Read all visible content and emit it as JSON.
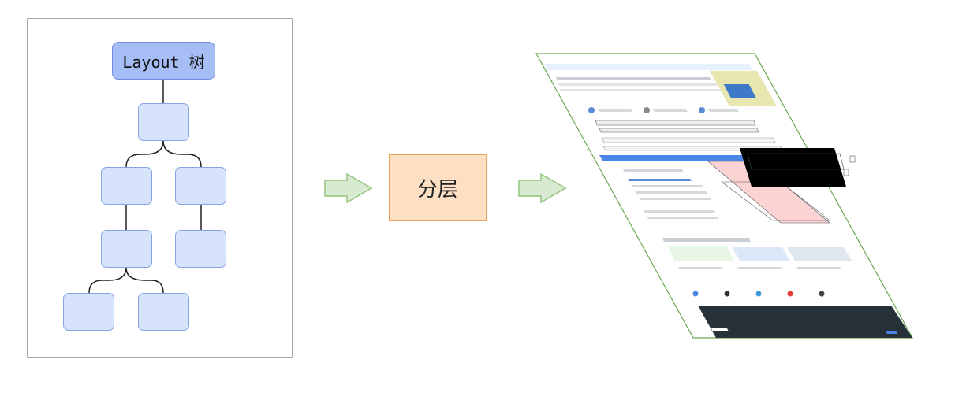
{
  "tree": {
    "root_label": "Layout 树"
  },
  "process": {
    "label": "分层"
  },
  "colors": {
    "root_fill": "#a6bdf5",
    "node_fill": "#d6e3fb",
    "node_border": "#85a3e2",
    "layer_fill": "#fddfc3",
    "layer_border": "#e6a35a",
    "arrow_fill": "#d9ead3",
    "arrow_border": "#93c47d"
  },
  "icons": [
    "right-arrow-icon",
    "layered-page-illustration"
  ]
}
